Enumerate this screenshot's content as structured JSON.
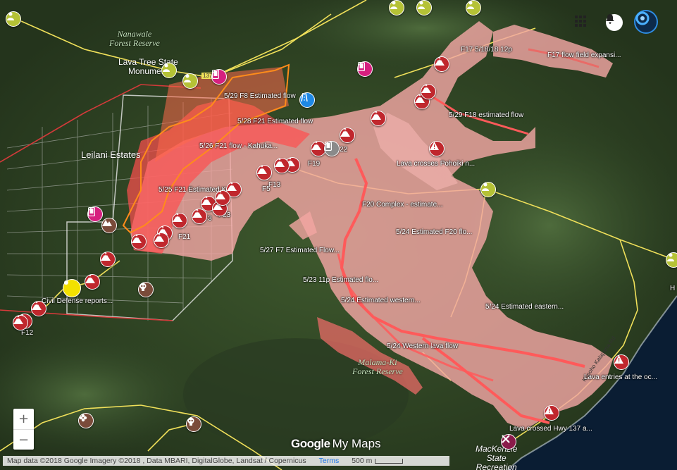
{
  "map": {
    "places": {
      "nanawale": "Nanawale\nForest Reserve",
      "lava_tree": "Lava Tree State\nMonument",
      "leilani": "Leilani Estates",
      "malama": "Malama-Ki\nForest Reserve",
      "mackenzie": "MacKenzie\nState\nRecreation"
    },
    "flow_labels": [
      "F17 5/18/18 12p",
      "F17 flow field expansi...",
      "5/29 F8 Estimated flow",
      "5/28 F21 Estimated flow",
      "5/29 F18 estimated flow",
      "5/26 F21 flow - Kahuka...",
      "Lava crosses Pohoiki n...",
      "5/25 F21 Estimated Ka...",
      "F20 Complex - estimate...",
      "5/24 Estimated F20 flo...",
      "5/27 F7 Estimated Flow...",
      "5/23 11p Estimated flo...",
      "5/24 Estimated western...",
      "5/24 Estimated eastern...",
      "5/24 Western lava flow",
      "Lava entries at the oc...",
      "Lava crossed Hwy 137 a...",
      "Civil Defense reports..."
    ],
    "fissure_labels": [
      "F22",
      "F19",
      "F5",
      "F13",
      "F3",
      "F23",
      "F21",
      "F12"
    ],
    "road_labels": [
      "137",
      "Kapoho Kalapana Rd",
      "H"
    ]
  },
  "attribution": {
    "text": "Map data ©2018 Google Imagery ©2018 , Data MBARI, DigitalGlobe, Landsat / Copernicus",
    "terms": "Terms",
    "scale": "500 m"
  },
  "logo": {
    "google": "Google",
    "mymaps": "My Maps"
  },
  "zoom": {
    "in": "+",
    "out": "−"
  },
  "colors": {
    "lava_fill": "#f2a6a3",
    "lava_dark": "#e96b67",
    "lava_red": "#ff5a5a",
    "old_flow": "#ff6a4d",
    "outline_orange": "#ff8c1a",
    "road_yellow": "#f0e05a",
    "boundary_red": "#d43a3a",
    "pin_lava": "#c0272d",
    "pin_yellowgreen": "#b5c236",
    "pin_magenta": "#d6207f",
    "pin_blue": "#1e88e5",
    "pin_brown": "#7a4b3a"
  }
}
